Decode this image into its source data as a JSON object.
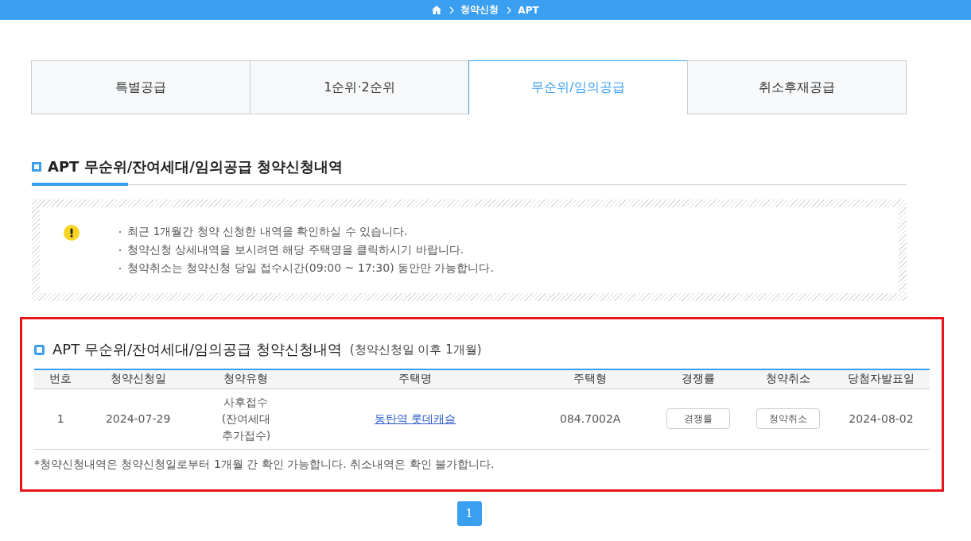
{
  "breadcrumb": [
    "청약신청",
    "APT"
  ],
  "tabs": [
    {
      "label": "특별공급",
      "selected": false
    },
    {
      "label": "1순위·2순위",
      "selected": false
    },
    {
      "label": "무순위/임의공급",
      "selected": true
    },
    {
      "label": "취소후재공급",
      "selected": false
    }
  ],
  "section_title": "APT 무순위/잔여세대/임의공급 청약신청내역",
  "notices": [
    "최근 1개월간 청약 신청한 내역을 확인하실 수 있습니다.",
    "청약신청 상세내역을 보시려면 해당 주택명을 클릭하시기 바랍니다.",
    "청약취소는 청약신청 당일 접수시간(09:00 ~ 17:30) 동안만 가능합니다."
  ],
  "results": {
    "highlighted": true,
    "title": "APT 무순위/잔여세대/임의공급 청약신청내역",
    "subtitle": "(청약신청일 이후 1개월)",
    "columns": [
      "번호",
      "청약신청일",
      "청약유형",
      "주택명",
      "주택형",
      "경쟁률",
      "청약취소",
      "당첨자발표일"
    ],
    "rows": [
      [
        {
          "kind": "text",
          "text": "1"
        },
        {
          "kind": "text",
          "text": "2024-07-29"
        },
        {
          "kind": "lines",
          "lines": [
            "사후접수",
            "(잔여세대",
            "추가접수)"
          ]
        },
        {
          "kind": "link",
          "text": "동탄역 롯데캐슬"
        },
        {
          "kind": "text",
          "text": "084.7002A"
        },
        {
          "kind": "button",
          "text": "경쟁률"
        },
        {
          "kind": "button",
          "text": "청약취소"
        },
        {
          "kind": "text",
          "text": "2024-08-02"
        }
      ]
    ],
    "footnote": "*청약신청내역은 청약신청일로부터 1개월 간 확인 가능합니다. 취소내역은 확인 불가합니다."
  },
  "pagination": [
    {
      "label": "1",
      "selected": true
    }
  ]
}
